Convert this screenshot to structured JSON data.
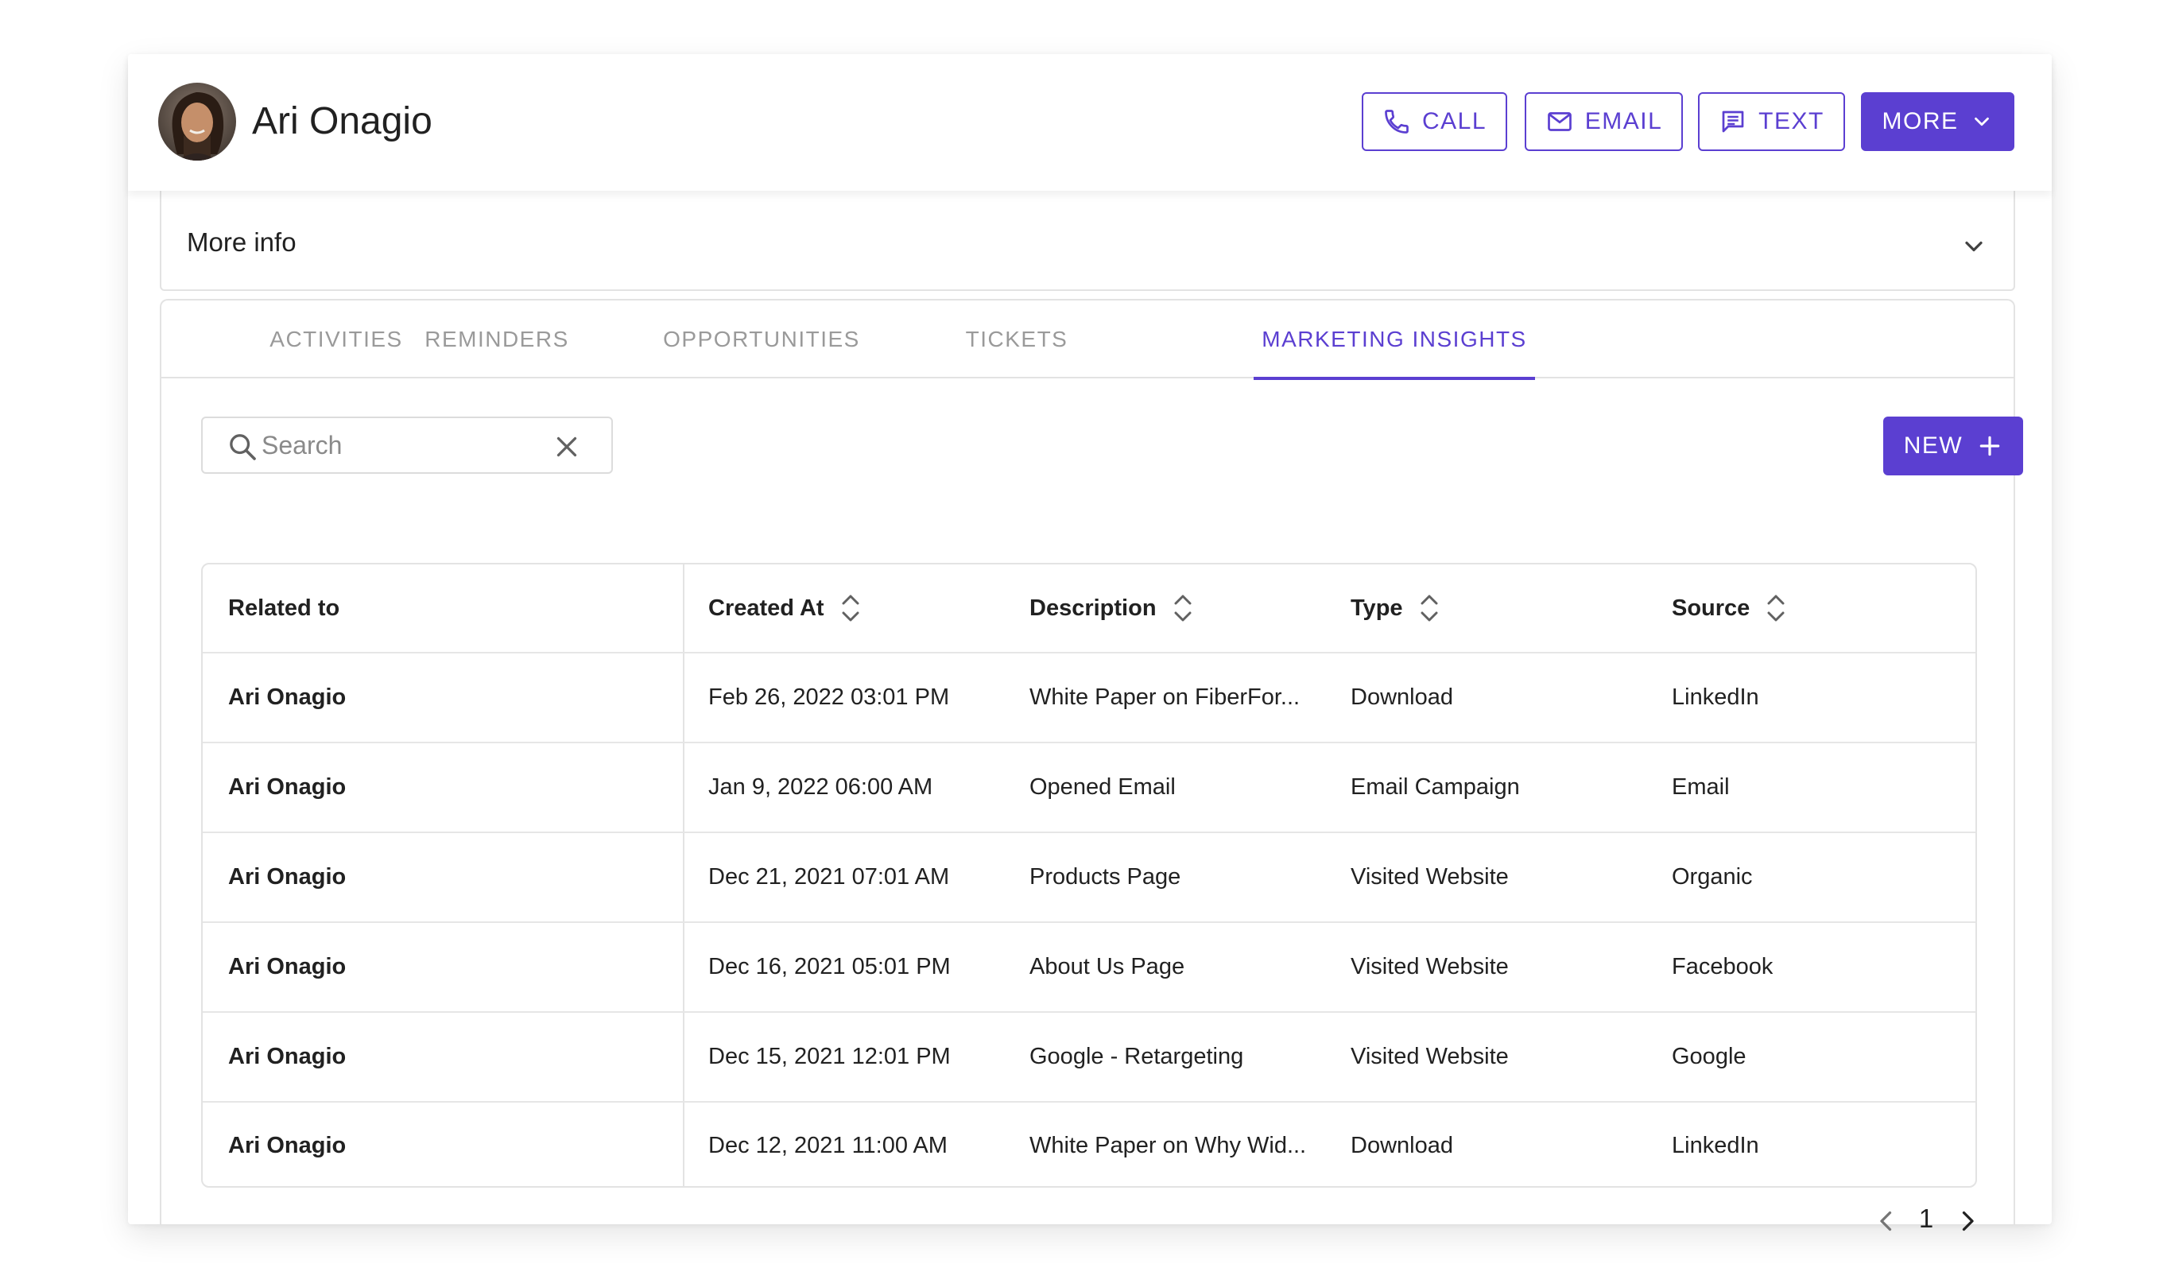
{
  "contact": {
    "name": "Ari Onagio"
  },
  "header": {
    "call_label": "CALL",
    "email_label": "EMAIL",
    "text_label": "TEXT",
    "more_label": "MORE"
  },
  "more_info": {
    "label": "More info"
  },
  "tabs": [
    {
      "label": "ACTIVITIES",
      "active": false
    },
    {
      "label": "REMINDERS",
      "active": false
    },
    {
      "label": "OPPORTUNITIES",
      "active": false
    },
    {
      "label": "TICKETS",
      "active": false
    },
    {
      "label": "MARKETING INSIGHTS",
      "active": true
    }
  ],
  "search": {
    "placeholder": "Search",
    "value": ""
  },
  "new_button": {
    "label": "NEW"
  },
  "table": {
    "columns": [
      {
        "label": "Related to",
        "sortable": false
      },
      {
        "label": "Created At",
        "sortable": true
      },
      {
        "label": "Description",
        "sortable": true
      },
      {
        "label": "Type",
        "sortable": true
      },
      {
        "label": "Source",
        "sortable": true
      }
    ],
    "rows": [
      {
        "related": "Ari Onagio",
        "created": "Feb 26, 2022 03:01 PM",
        "description": "White Paper on FiberFor...",
        "type": "Download",
        "source": "LinkedIn"
      },
      {
        "related": "Ari Onagio",
        "created": "Jan 9, 2022 06:00 AM",
        "description": "Opened Email",
        "type": "Email Campaign",
        "source": "Email"
      },
      {
        "related": "Ari Onagio",
        "created": "Dec 21, 2021 07:01 AM",
        "description": "Products Page",
        "type": "Visited Website",
        "source": "Organic"
      },
      {
        "related": "Ari Onagio",
        "created": "Dec 16, 2021 05:01 PM",
        "description": "About Us Page",
        "type": "Visited Website",
        "source": "Facebook"
      },
      {
        "related": "Ari Onagio",
        "created": "Dec 15, 2021 12:01 PM",
        "description": "Google - Retargeting",
        "type": "Visited Website",
        "source": "Google"
      },
      {
        "related": "Ari Onagio",
        "created": "Dec 12, 2021 11:00 AM",
        "description": "White Paper on Why Wid...",
        "type": "Download",
        "source": "LinkedIn"
      }
    ]
  },
  "pagination": {
    "current_page": "1"
  },
  "colors": {
    "accent": "#5b3fd1",
    "border": "#e3e3e3",
    "muted_text": "#9a9a9a"
  },
  "icons": {
    "call": "phone-icon",
    "email": "envelope-icon",
    "text": "chat-icon",
    "more": "chevron-down-icon",
    "search": "search-icon",
    "clear": "close-icon",
    "new": "plus-icon",
    "sort": "sort-icon",
    "prev": "chevron-left-icon",
    "next": "chevron-right-icon"
  }
}
